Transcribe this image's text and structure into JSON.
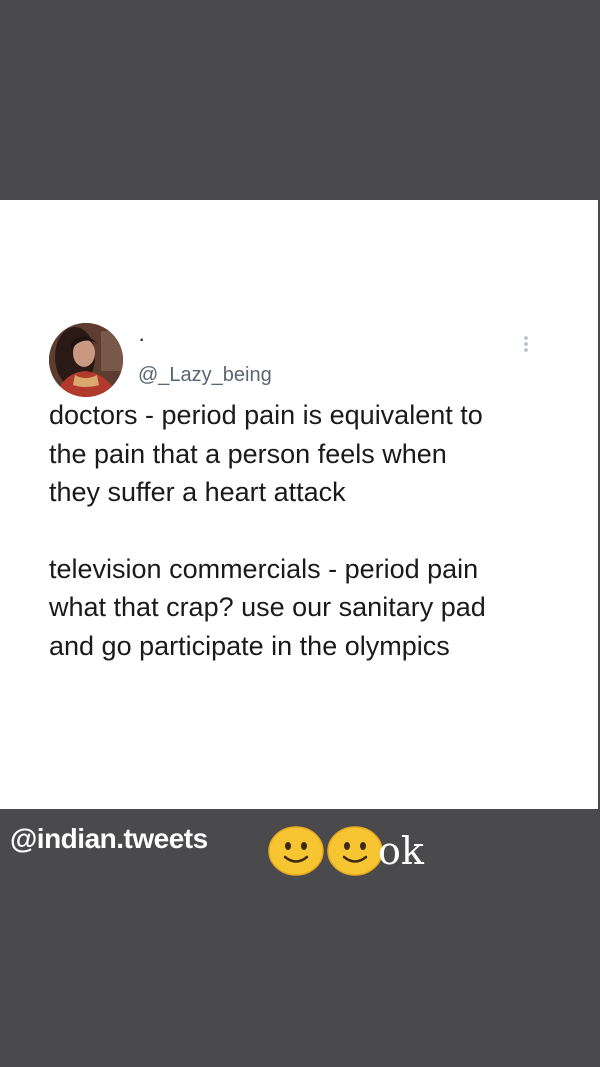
{
  "tweet": {
    "display_name": "·",
    "handle": "@_Lazy_being",
    "paragraphs": [
      "doctors - period pain is equivalent to\nthe pain that a person feels when\nthey suffer a heart attack",
      "television commercials - period pain\nwhat that crap? use our sanitary pad\nand go participate in the olympics"
    ],
    "avatar_icon": "profile-photo",
    "more_icon": "vertical-ellipsis"
  },
  "overlay": {
    "watermark": "@indian.tweets",
    "sticker_emojis": [
      "slightly-smiling-face",
      "slightly-smiling-face"
    ],
    "sticker_text": "ok"
  },
  "colors": {
    "background": "#4a494b",
    "card": "#ffffff",
    "emoji": "#f7c531"
  }
}
